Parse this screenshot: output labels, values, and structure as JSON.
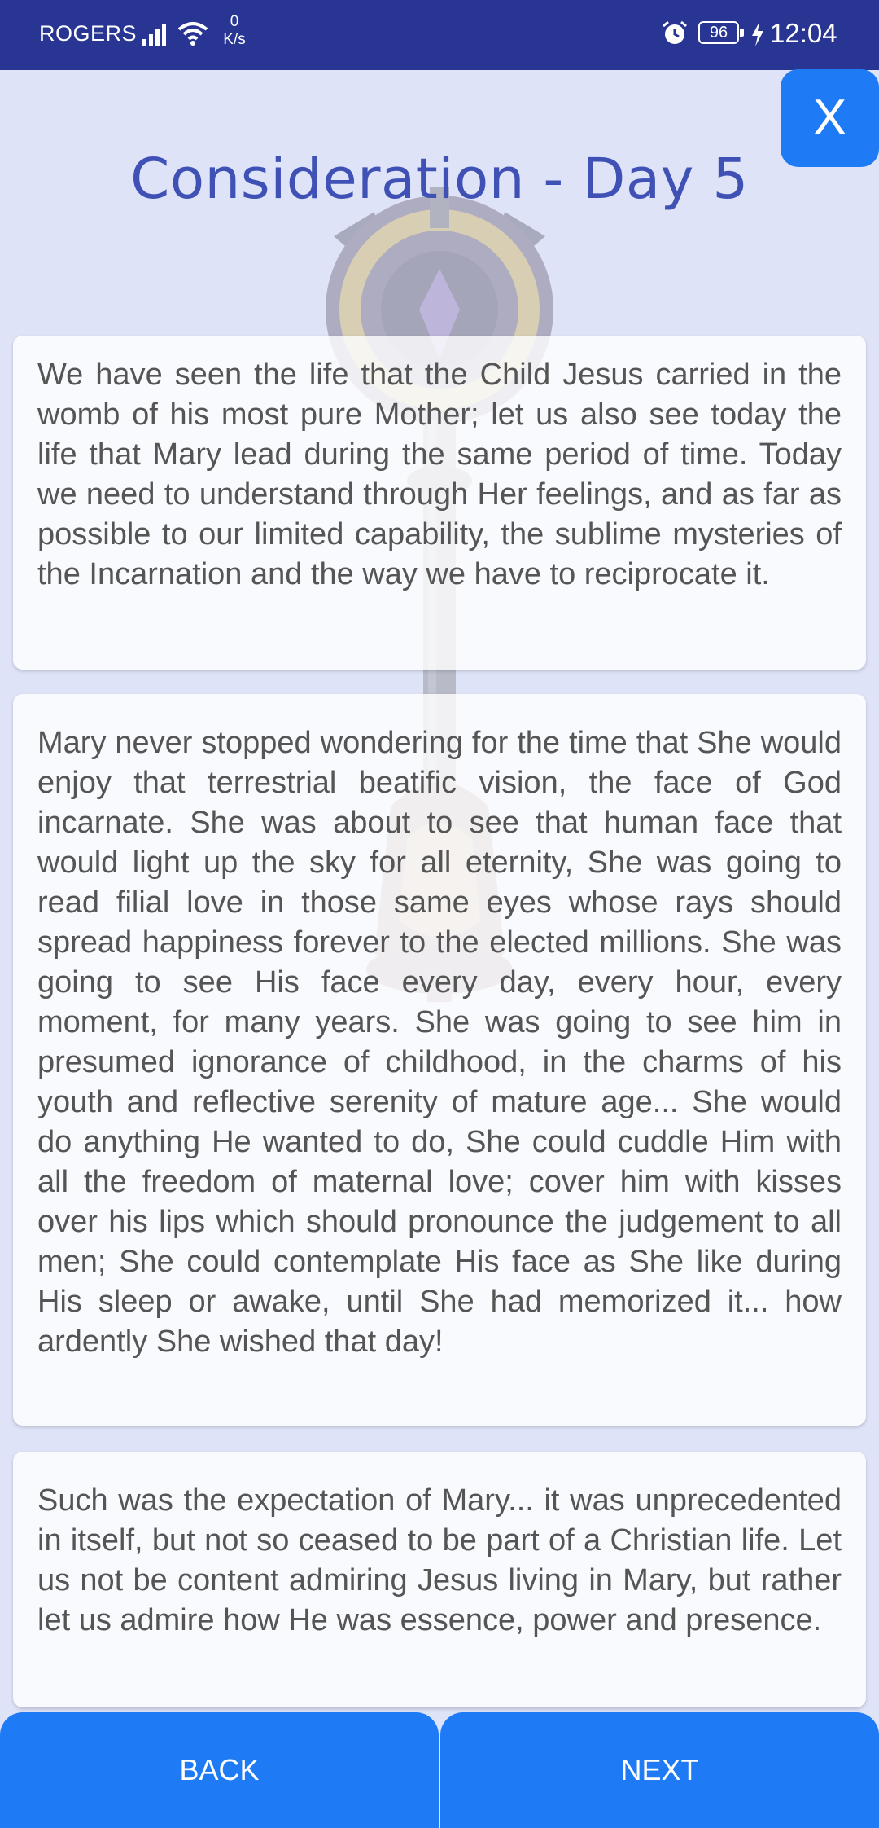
{
  "status_bar": {
    "carrier": "ROGERS",
    "net_speed_value": "0",
    "net_speed_unit": "K/s",
    "battery_level": "96",
    "time": "12:04"
  },
  "header": {
    "close_label": "X",
    "title": "Consideration - Day 5"
  },
  "cards": [
    {
      "text": "We have seen the life that the Child Jesus carried in the womb of his most pure Mother; let us also see today the life that Mary lead during the same period of time. Today we need to understand through Her feelings, and as far as possible to our limited capability, the sublime mysteries of the Incarnation and the way we have to reciprocate it."
    },
    {
      "text": "Mary never stopped wondering for the time that She would enjoy that terrestrial beatific vision, the face of God incarnate. She was about to see that human face that would light up the sky for all eternity, She was going to read filial love in those same eyes whose rays should spread happiness forever to the elected millions. She was going to see His face every day, every hour, every moment, for many years. She was going to see him in presumed ignorance of childhood, in the charms of his youth and reflective serenity of mature age... She would do anything He wanted to do, She could cuddle Him with all the freedom of maternal love; cover him with kisses over his lips which should pronounce the judgement to all men; She could contemplate His face as She like during His sleep or awake, until She had memorized it... how ardently She wished that day!"
    },
    {
      "text": "Such was the expectation of Mary... it was unprecedented in itself, but not so ceased to be part of a Christian life. Let us not be content admiring Jesus living in Mary, but rather let us admire how He was essence, power and presence."
    }
  ],
  "footer": {
    "back_label": "BACK",
    "next_label": "NEXT"
  },
  "colors": {
    "status_bar": "#283593",
    "accent_button": "#1e7bf5",
    "title": "#3f51b5",
    "background": "#dfe3f8",
    "body_text": "#555555"
  }
}
